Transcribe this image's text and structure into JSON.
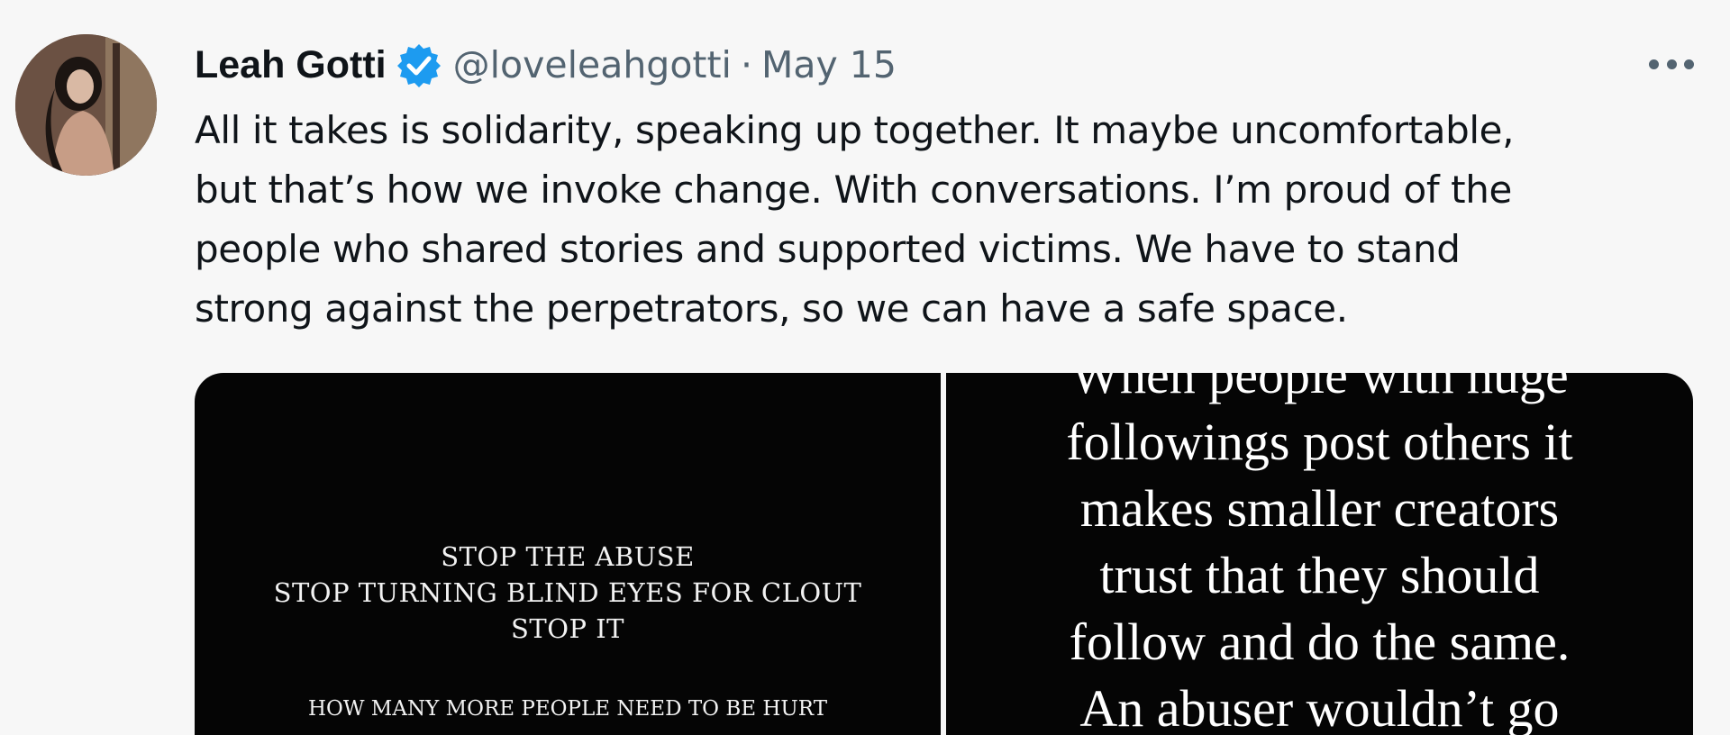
{
  "author": {
    "name": "Leah Gotti",
    "handle": "@loveleahgotti",
    "separator": "·",
    "date": "May 15",
    "verified": true
  },
  "tweet": {
    "text": "All it takes is solidarity, speaking up together. It maybe uncomfortable,\nbut that’s how we invoke change. With conversations. I’m proud of the\npeople who shared stories and supported victims. We have to stand\nstrong against the perpetrators, so we can have a safe space."
  },
  "media": {
    "left_image": {
      "lines": [
        "STOP THE ABUSE",
        "STOP TURNING BLIND EYES FOR CLOUT",
        "STOP IT"
      ],
      "small_line": "HOW MANY MORE PEOPLE NEED TO BE HURT"
    },
    "right_image": {
      "lines": [
        "When people with huge",
        "followings post others it",
        "makes smaller creators",
        "trust that they should",
        "follow and do the same.",
        "An abuser wouldn’t go"
      ]
    }
  },
  "icons": {
    "verified": "verified-badge-icon",
    "more": "more-options-icon"
  },
  "colors": {
    "verified_blue": "#1d9bf0",
    "secondary_text": "#536471",
    "primary_text": "#0f1419",
    "background": "#f7f7f7"
  }
}
